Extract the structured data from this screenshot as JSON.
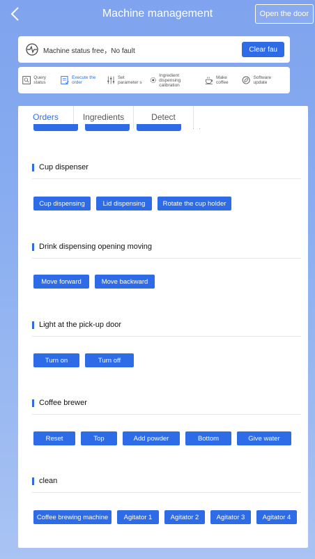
{
  "header": {
    "title": "Machine management",
    "door_button": "Open the door"
  },
  "status": {
    "text": "Machine status free，No fault",
    "clear_button": "Clear fau"
  },
  "menu": [
    {
      "label": "Query status",
      "icon": "query-icon"
    },
    {
      "label": "Execute the order",
      "icon": "execute-icon",
      "active": true
    },
    {
      "label": "Set parameter s",
      "icon": "sliders-icon"
    },
    {
      "label": "Ingredient dispensing calibration",
      "icon": "calibration-icon"
    },
    {
      "label": "Make coffee",
      "icon": "coffee-cup-icon"
    },
    {
      "label": "Software update",
      "icon": "update-icon"
    }
  ],
  "tabs": [
    "Orders",
    "Ingredients",
    "Detect"
  ],
  "sections": [
    {
      "title": "Cup dispenser",
      "buttons": [
        "Cup dispensing",
        "Lid dispensing",
        "Rotate the cup holder"
      ]
    },
    {
      "title": "Drink dispensing opening moving",
      "buttons": [
        "Move forward",
        "Move backward"
      ]
    },
    {
      "title": "Light at the pick-up door",
      "buttons": [
        "Turn on",
        "Turn off"
      ]
    },
    {
      "title": "Coffee brewer",
      "buttons": [
        "Reset",
        "Top",
        "Add powder",
        "Bottom",
        "Give water"
      ]
    },
    {
      "title": "clean",
      "buttons": [
        "Coffee brewing machine",
        "Agitator 1",
        "Agitator 2",
        "Agitator 3",
        "Agitator 4"
      ]
    }
  ],
  "colors": {
    "accent": "#2e6be6",
    "background": "#8aaef0"
  }
}
